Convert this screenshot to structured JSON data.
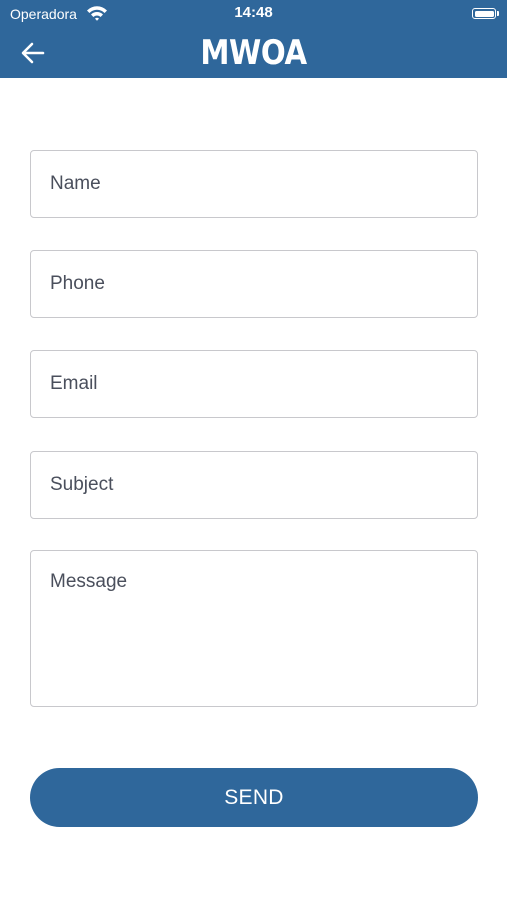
{
  "status_bar": {
    "carrier": "Operadora",
    "time": "14:48",
    "wifi_icon": "wifi-icon",
    "battery_icon": "battery-icon",
    "battery_level": 1.0
  },
  "header": {
    "back_icon": "arrow-left-icon",
    "title": "MWOA",
    "background_color": "#2f679b"
  },
  "form": {
    "name": {
      "placeholder": "Name",
      "value": ""
    },
    "phone": {
      "placeholder": "Phone",
      "value": ""
    },
    "email": {
      "placeholder": "Email",
      "value": ""
    },
    "subject": {
      "placeholder": "Subject",
      "value": ""
    },
    "message": {
      "placeholder": "Message",
      "value": ""
    }
  },
  "send_button": {
    "label": "SEND",
    "color": "#2f679b"
  }
}
